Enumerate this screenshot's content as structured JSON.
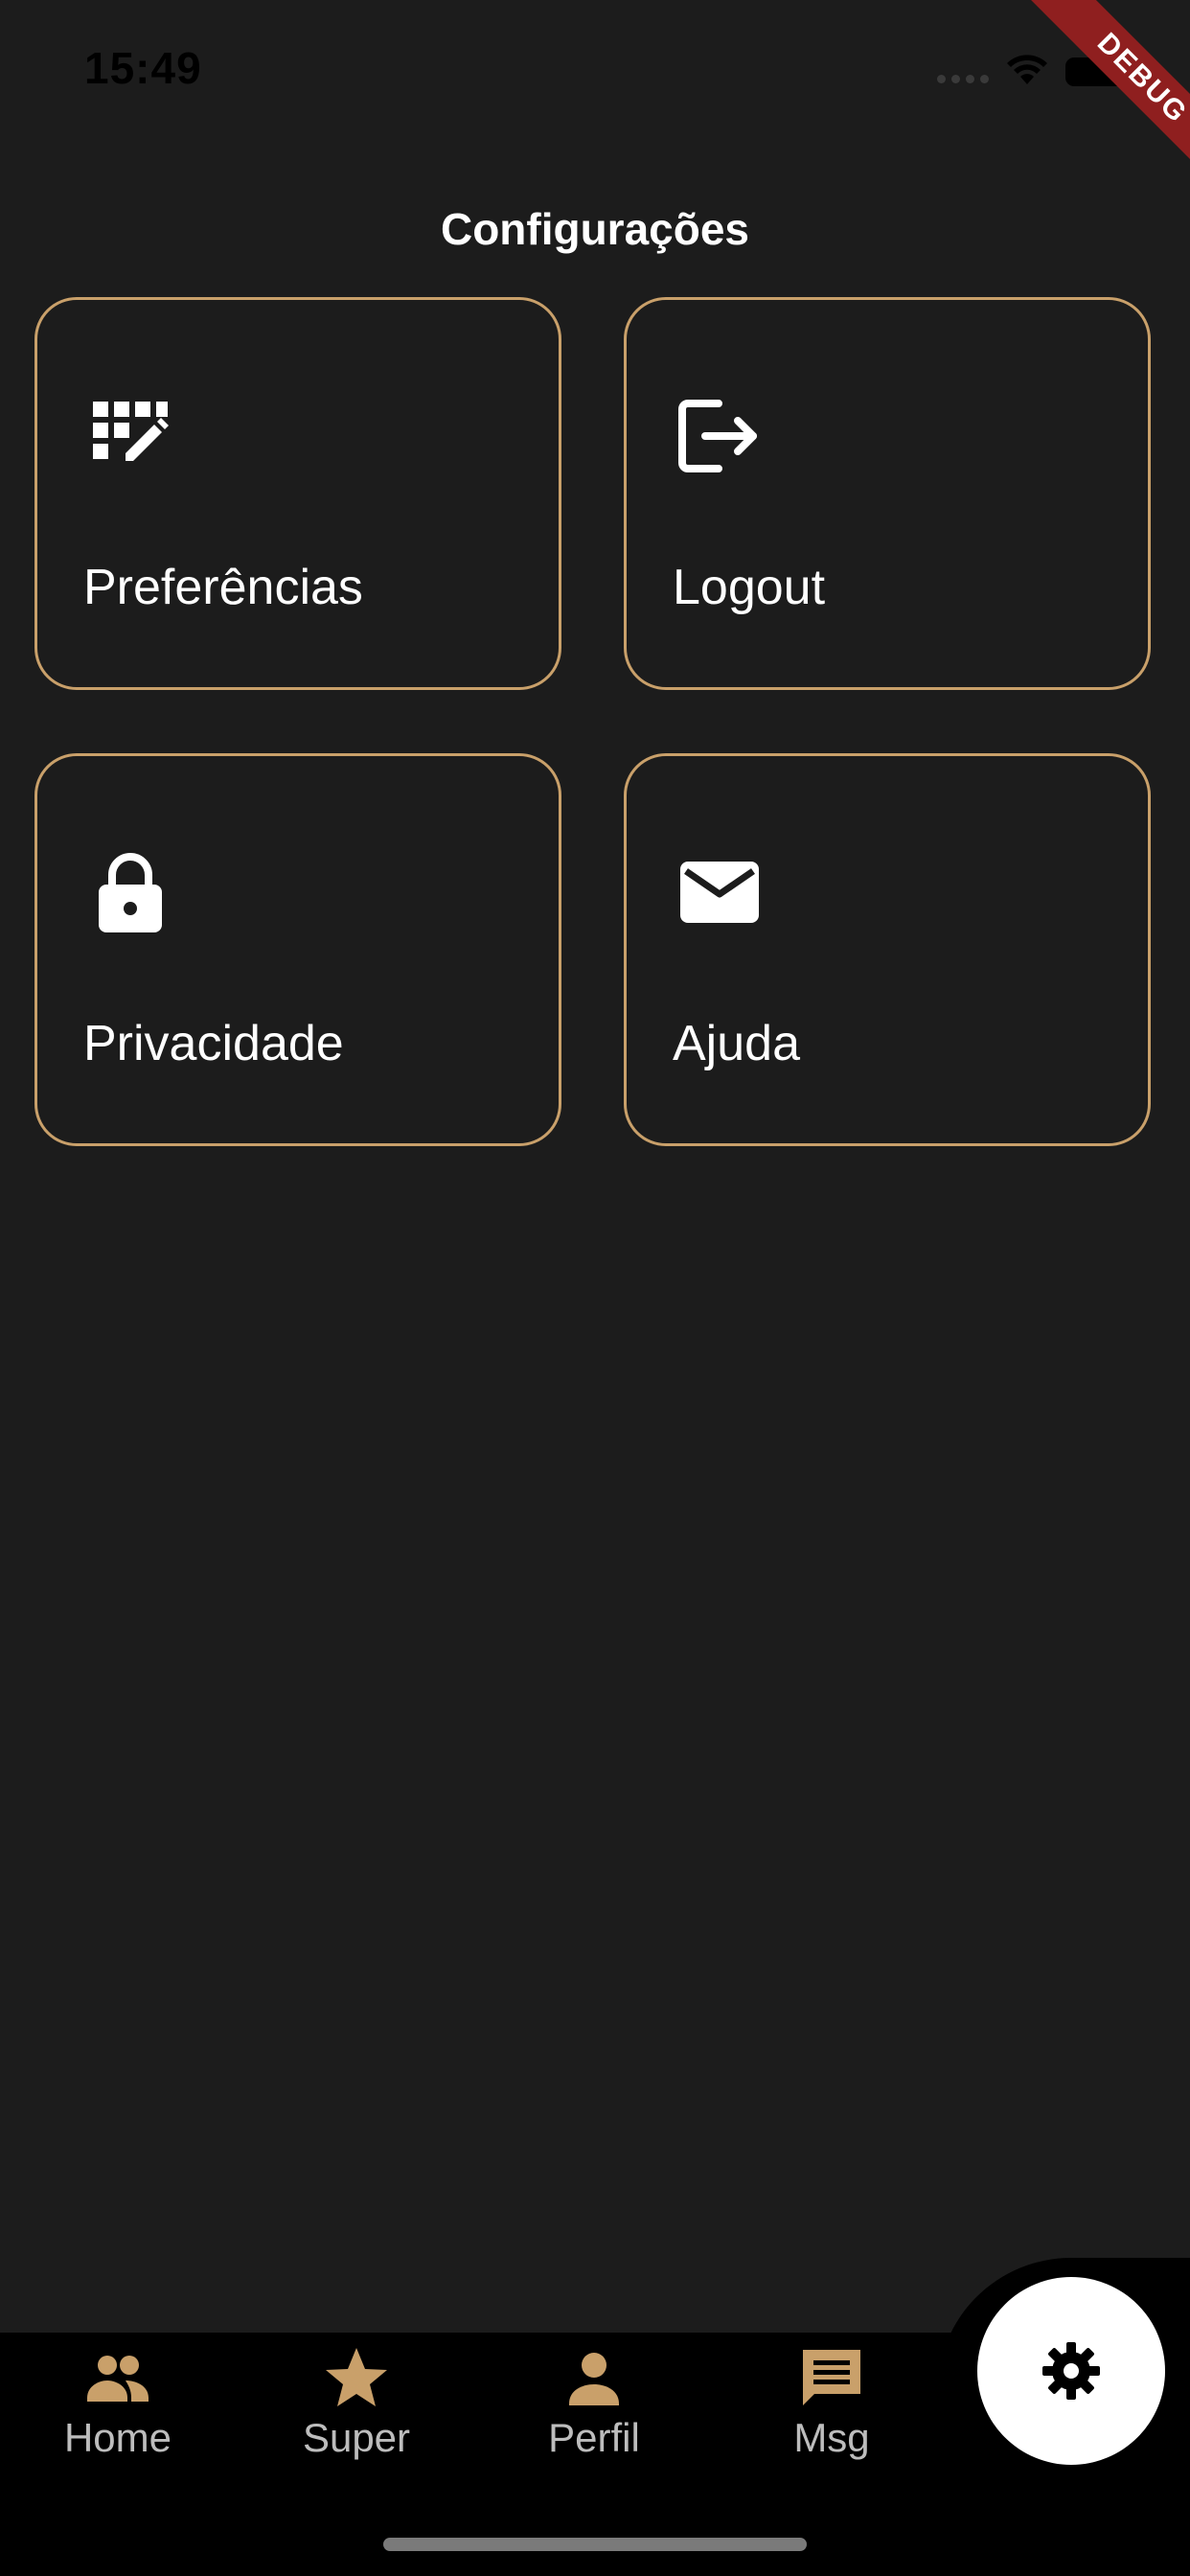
{
  "status_bar": {
    "time": "15:49"
  },
  "debug_banner": "DEBUG",
  "header": {
    "title": "Configurações"
  },
  "cards": [
    {
      "label": "Preferências",
      "icon": "edit-grid-icon"
    },
    {
      "label": "Logout",
      "icon": "logout-icon"
    },
    {
      "label": "Privacidade",
      "icon": "lock-icon"
    },
    {
      "label": "Ajuda",
      "icon": "mail-icon"
    }
  ],
  "bottom_nav": {
    "items": [
      {
        "label": "Home",
        "icon": "people-icon"
      },
      {
        "label": "Super",
        "icon": "star-icon"
      },
      {
        "label": "Perfil",
        "icon": "person-icon"
      },
      {
        "label": "Msg",
        "icon": "message-icon"
      }
    ],
    "fab_icon": "gear-icon"
  },
  "colors": {
    "background": "#1c1c1c",
    "accent": "#c9a06a",
    "nav_background": "#000000",
    "debug": "#8f1f1f"
  }
}
